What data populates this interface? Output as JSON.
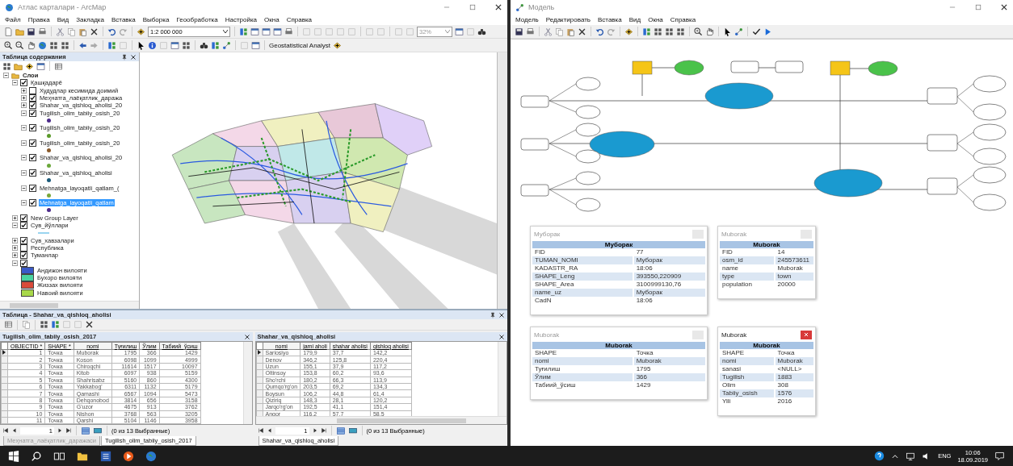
{
  "arcmap": {
    "title": "Атлас карталари - ArcMap",
    "menu": [
      "Файл",
      "Правка",
      "Вид",
      "Закладка",
      "Вставка",
      "Выборка",
      "Геообработка",
      "Настройка",
      "Окна",
      "Справка"
    ],
    "toolbar": {
      "scale": "1:2 000 000",
      "zoom": "32%",
      "extension": "Geostatistical Analyst"
    },
    "toc": {
      "title": "Таблица содержания",
      "tree": [
        {
          "kind": "frame",
          "label": "Слои",
          "expanded": true,
          "selected": false,
          "children": [
            {
              "kind": "layer",
              "label": "Қашқадарё",
              "checked": true,
              "expanded": true,
              "selected": false,
              "children": [
                {
                  "kind": "layer",
                  "label": "Худудлар кесимида доимий",
                  "checked": false,
                  "expanded": false,
                  "selected": false
                },
                {
                  "kind": "layer",
                  "label": "Меҳнатга_лаёқатлик_даража",
                  "checked": true,
                  "expanded": false,
                  "selected": false
                },
                {
                  "kind": "layer",
                  "label": "Shahar_va_qishloq_aholisi_20",
                  "checked": true,
                  "expanded": false,
                  "selected": false
                },
                {
                  "kind": "point_layer",
                  "label": "Tugilish_olim_tabiiy_osish_20",
                  "checked": true,
                  "expanded": true,
                  "selected": false,
                  "color": "#4b2a8a"
                },
                {
                  "kind": "point_layer",
                  "label": "Tugilish_olim_tabiiy_osish_20",
                  "checked": true,
                  "expanded": true,
                  "selected": false,
                  "color": "#5a9a2a"
                },
                {
                  "kind": "point_layer",
                  "label": "Tugilish_olim_tabiiy_osish_20",
                  "checked": true,
                  "expanded": true,
                  "selected": false,
                  "color": "#8a5a2a"
                },
                {
                  "kind": "point_layer",
                  "label": "Shahar_va_qishloq_aholisi_20",
                  "checked": true,
                  "expanded": true,
                  "selected": false,
                  "color": "#6aa83a"
                },
                {
                  "kind": "point_layer",
                  "label": "Shahar_va_qishloq_aholisi",
                  "checked": true,
                  "expanded": true,
                  "selected": false,
                  "color": "#1a5a7a"
                },
                {
                  "kind": "point_layer",
                  "label": "Mehnatga_layoqatli_qatlam_(",
                  "checked": true,
                  "expanded": true,
                  "selected": false,
                  "color": "#7aa83a"
                },
                {
                  "kind": "point_layer",
                  "label": "Mehnatga_layoqatli_qatlam",
                  "checked": true,
                  "expanded": true,
                  "selected": true,
                  "color": "#4b2a8a"
                }
              ]
            },
            {
              "kind": "layer",
              "label": "New Group Layer",
              "checked": true,
              "expanded": false,
              "selected": false
            },
            {
              "kind": "line_layer",
              "label": "Сув_йўллари",
              "checked": true,
              "expanded": true,
              "selected": false,
              "color": "#9ad4f0"
            },
            {
              "kind": "layer",
              "label": "Сув_хавзалари",
              "checked": true,
              "expanded": false,
              "selected": false
            },
            {
              "kind": "layer",
              "label": "Республика",
              "checked": false,
              "expanded": false,
              "selected": false
            },
            {
              "kind": "layer",
              "label": "Туманлар",
              "checked": true,
              "expanded": false,
              "selected": false
            },
            {
              "kind": "layer",
              "checked": true,
              "expanded": true,
              "children": [
                {
                  "kind": "legend",
                  "label": "Андижон вилояти",
                  "color": "#3a5ac8",
                  "selected": false
                },
                {
                  "kind": "legend",
                  "label": "Бухоро вилояти",
                  "color": "#4ad4a0",
                  "selected": false
                },
                {
                  "kind": "legend",
                  "label": "Жиззах вилояти",
                  "color": "#d84a3a",
                  "selected": false
                },
                {
                  "kind": "legend",
                  "label": "Навоий вилояти",
                  "color": "#a8d84a",
                  "selected": false
                }
              ]
            }
          ]
        }
      ]
    },
    "table_window": {
      "title": "Таблица - Shahar_va_qishloq_aholisi",
      "tables": [
        {
          "title": "Tugilish_olim_tabiiy_osish_2017",
          "columns": [
            {
              "label": "OBJECTID *",
              "kind": "number"
            },
            {
              "label": "SHAPE *",
              "kind": "text"
            },
            {
              "label": "nomi",
              "kind": "text"
            },
            {
              "label": "Туғилиш",
              "kind": "number"
            },
            {
              "label": "Ўлим",
              "kind": "number"
            },
            {
              "label": "Табиий_ўсиш",
              "kind": "number"
            }
          ],
          "rows": [
            {
              "current": true,
              "cells": [
                "1",
                "Точка",
                "Muborak",
                "1795",
                "366",
                "1429"
              ]
            },
            {
              "current": false,
              "cells": [
                "2",
                "Точка",
                "Koson",
                "6098",
                "1099",
                "4999"
              ]
            },
            {
              "current": false,
              "cells": [
                "3",
                "Точка",
                "Chiroqchi",
                "11614",
                "1517",
                "10097"
              ]
            },
            {
              "current": false,
              "cells": [
                "4",
                "Точка",
                "Kitob",
                "6097",
                "938",
                "5159"
              ]
            },
            {
              "current": false,
              "cells": [
                "5",
                "Точка",
                "Shahrisabz",
                "5160",
                "860",
                "4300"
              ]
            },
            {
              "current": false,
              "cells": [
                "6",
                "Точка",
                "Yakkabog'",
                "6311",
                "1132",
                "5179"
              ]
            },
            {
              "current": false,
              "cells": [
                "7",
                "Точка",
                "Qamashi",
                "6567",
                "1094",
                "5473"
              ]
            },
            {
              "current": false,
              "cells": [
                "8",
                "Точка",
                "Dehqonobod",
                "3814",
                "656",
                "3158"
              ]
            },
            {
              "current": false,
              "cells": [
                "9",
                "Точка",
                "G'uzor",
                "4675",
                "913",
                "3762"
              ]
            },
            {
              "current": false,
              "cells": [
                "10",
                "Точка",
                "Nishon",
                "3768",
                "563",
                "3205"
              ]
            },
            {
              "current": false,
              "cells": [
                "11",
                "Точка",
                "Qarshi",
                "5104",
                "1146",
                "3958"
              ]
            }
          ],
          "record": "1",
          "status": "(0 из 13 Выбранные)",
          "tabs": [
            {
              "label": "Меҳнатга_лаёқатлик_даражаси",
              "selected": false
            },
            {
              "label": "Tugilish_olim_tabiiy_osish_2017",
              "selected": true
            }
          ]
        },
        {
          "title": "Shahar_va_qishloq_aholisi",
          "columns": [
            {
              "label": "nomi",
              "kind": "text"
            },
            {
              "label": "jami aholi",
              "kind": "text"
            },
            {
              "label": "shahar aholisi",
              "kind": "text"
            },
            {
              "label": "qishloq aholisi",
              "kind": "text"
            }
          ],
          "rows": [
            {
              "current": true,
              "cells": [
                "Sariosiyo",
                "179,9",
                "37,7",
                "142,2"
              ]
            },
            {
              "current": false,
              "cells": [
                "Denov",
                "346,2",
                "125,8",
                "220,4"
              ]
            },
            {
              "current": false,
              "cells": [
                "Uzun",
                "155,1",
                "37,9",
                "117,2"
              ]
            },
            {
              "current": false,
              "cells": [
                "Oltinsoy",
                "153,8",
                "60,2",
                "93,6"
              ]
            },
            {
              "current": false,
              "cells": [
                "Sho'rchi",
                "180,2",
                "66,3",
                "113,9"
              ]
            },
            {
              "current": false,
              "cells": [
                "Qumqo'rg'on",
                "203,5",
                "69,2",
                "134,3"
              ]
            },
            {
              "current": false,
              "cells": [
                "Boysun",
                "106,2",
                "44,8",
                "61,4"
              ]
            },
            {
              "current": false,
              "cells": [
                "Qiziriq",
                "148,3",
                "28,1",
                "120,2"
              ]
            },
            {
              "current": false,
              "cells": [
                "Jarqo'rg'on",
                "192,5",
                "41,1",
                "151,4"
              ]
            },
            {
              "current": false,
              "cells": [
                "Angor",
                "116,2",
                "57,7",
                "58,5"
              ]
            }
          ],
          "record": "1",
          "status": "(0 из 13 Выбранные)",
          "tabs": [
            {
              "label": "Shahar_va_qishloq_aholisi",
              "selected": true
            }
          ]
        }
      ]
    }
  },
  "model": {
    "title": "Модель",
    "menu": [
      "Модель",
      "Редактировать",
      "Вставка",
      "Вид",
      "Окна",
      "Справка"
    ],
    "popups": [
      {
        "title": "Муборак",
        "header": "Муборак",
        "close_active": false,
        "fields": [
          {
            "name": "FID",
            "value": "77"
          },
          {
            "name": "TUMAN_NOMI",
            "value": "Муборак"
          },
          {
            "name": "KADASTR_RA",
            "value": "18:06"
          },
          {
            "name": "SHAPE_Leng",
            "value": "393550,220909"
          },
          {
            "name": "SHAPE_Area",
            "value": "3100999130,76"
          },
          {
            "name": "name_uz",
            "value": "Муборак"
          },
          {
            "name": "CadN",
            "value": "18:06"
          }
        ]
      },
      {
        "title": "Muborak",
        "header": "Muborak",
        "close_active": false,
        "fields": [
          {
            "name": "FID",
            "value": "14"
          },
          {
            "name": "osm_id",
            "value": "245573611"
          },
          {
            "name": "name",
            "value": "Muborak"
          },
          {
            "name": "type",
            "value": "town"
          },
          {
            "name": "population",
            "value": "20000"
          }
        ]
      },
      {
        "title": "Muborak",
        "header": "Muborak",
        "close_active": false,
        "fields": [
          {
            "name": "SHAPE",
            "value": "Точка"
          },
          {
            "name": "nomi",
            "value": "Muborak"
          },
          {
            "name": "Туғилиш",
            "value": "1795"
          },
          {
            "name": "Ўлим",
            "value": "366"
          },
          {
            "name": "Табиий_ўсиш",
            "value": "1429"
          }
        ]
      },
      {
        "title": "Muborak",
        "header": "Muborak",
        "close_active": true,
        "fields": [
          {
            "name": "SHAPE",
            "value": "Точка"
          },
          {
            "name": "nomi",
            "value": "Muborak"
          },
          {
            "name": "sanasi",
            "value": "<NULL>"
          },
          {
            "name": "Tugilish",
            "value": "1883"
          },
          {
            "name": "Olim",
            "value": "308"
          },
          {
            "name": "Tabiiy_osish",
            "value": "1576"
          },
          {
            "name": "Yili",
            "value": "2016"
          }
        ]
      }
    ]
  },
  "taskbar": {
    "language": "ENG",
    "time": "10:06",
    "date": "18.09.2019"
  }
}
